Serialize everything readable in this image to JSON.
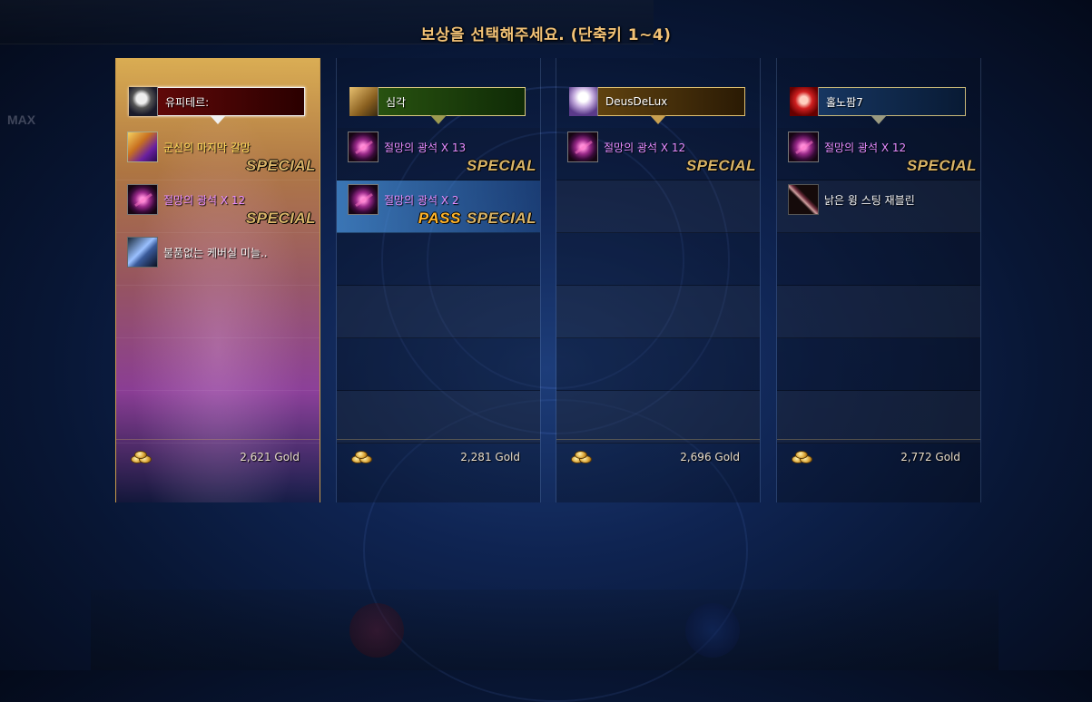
{
  "title": "보상을 선택해주세요. (단축키 1~4)",
  "colors": {
    "title": "#f2c276",
    "special_tag": "#d9b468",
    "pass_tag": "#ffb42a",
    "item_purple": "#e68cff",
    "item_gold": "#ffdb5a"
  },
  "players": [
    {
      "name": "유피테르:",
      "avatar_icon": "silver-haired-character-portrait",
      "bar_color": "red",
      "selected": true,
      "gold": "2,621",
      "gold_unit": "Gold",
      "items": [
        {
          "name": "군신의 마지막 갈망",
          "icon": "treasure-box-icon",
          "color": "gold",
          "tag": "SPECIAL"
        },
        {
          "name": "절망의 광석 X 12",
          "icon": "despair-ore-icon",
          "color": "purple",
          "tag": "SPECIAL"
        },
        {
          "name": "불품없는 케버실 미늘..",
          "icon": "weapon-icon",
          "color": "white",
          "tag": ""
        }
      ]
    },
    {
      "name": "심각",
      "avatar_icon": "golden-character-portrait",
      "bar_color": "green",
      "selected": false,
      "gold": "2,281",
      "gold_unit": "Gold",
      "items": [
        {
          "name": "절망의 광석 X 13",
          "icon": "despair-ore-icon",
          "color": "purple",
          "tag": "SPECIAL"
        },
        {
          "name": "절망의 광석 X 2",
          "icon": "despair-ore-icon",
          "color": "purple",
          "tag": "SPECIAL",
          "pass": "PASS",
          "highlight": true
        }
      ]
    },
    {
      "name": "DeusDeLux",
      "avatar_icon": "white-haired-character-portrait",
      "bar_color": "gold",
      "selected": false,
      "gold": "2,696",
      "gold_unit": "Gold",
      "items": [
        {
          "name": "절망의 광석 X 12",
          "icon": "despair-ore-icon",
          "color": "purple",
          "tag": "SPECIAL"
        }
      ]
    },
    {
      "name": "홀노팜7",
      "avatar_icon": "red-haired-character-portrait",
      "bar_color": "blue",
      "selected": false,
      "gold": "2,772",
      "gold_unit": "Gold",
      "items": [
        {
          "name": "절망의 광석 X 12",
          "icon": "despair-ore-icon",
          "color": "purple",
          "tag": "SPECIAL"
        },
        {
          "name": "낡은 윙 스팅 재블린",
          "icon": "javelin-icon",
          "color": "white",
          "tag": ""
        }
      ]
    }
  ],
  "hud": {
    "max_label": "MAX"
  }
}
